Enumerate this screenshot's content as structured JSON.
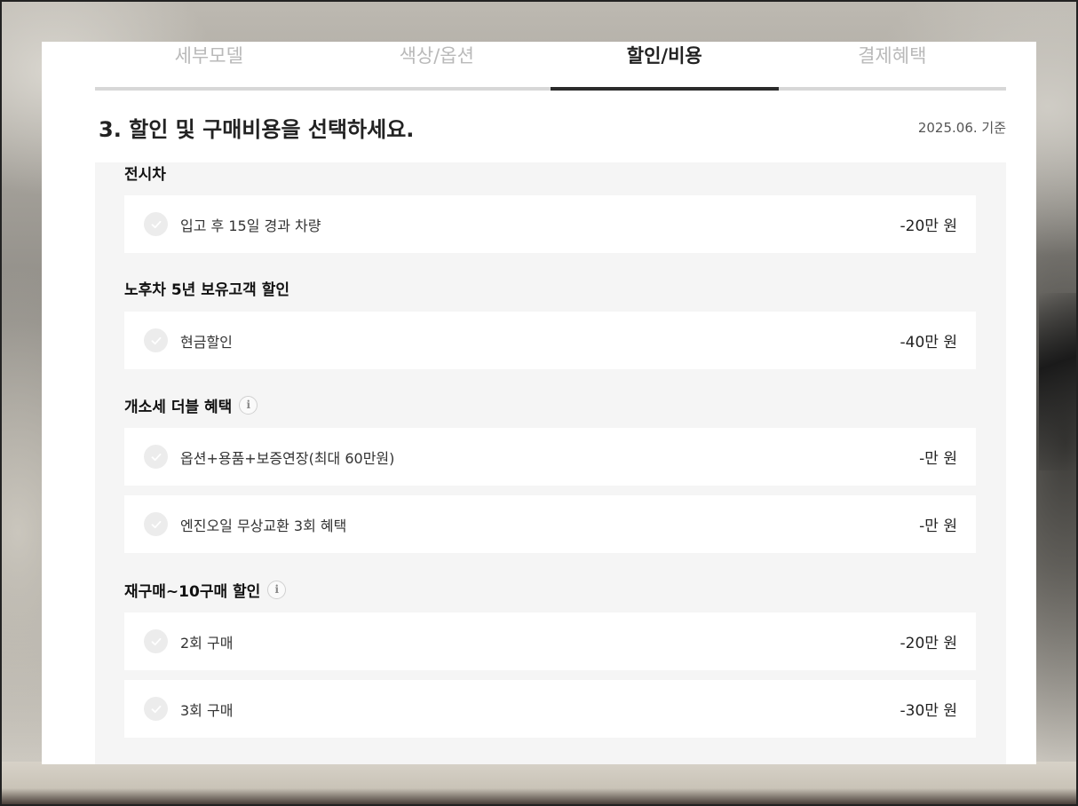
{
  "tabs": [
    {
      "label": "세부모델",
      "active": false
    },
    {
      "label": "색상/옵션",
      "active": false
    },
    {
      "label": "할인/비용",
      "active": true
    },
    {
      "label": "결제혜택",
      "active": false
    }
  ],
  "heading": {
    "title": "3. 할인 및 구매비용을 선택하세요.",
    "date_basis": "2025.06. 기준"
  },
  "groups": [
    {
      "title": "전시차",
      "has_info": false,
      "options": [
        {
          "label": "입고 후 15일 경과 차량",
          "value": "-20만 원"
        }
      ]
    },
    {
      "title": "노후차 5년 보유고객 할인",
      "has_info": false,
      "options": [
        {
          "label": "현금할인",
          "value": "-40만 원"
        }
      ]
    },
    {
      "title": "개소세 더블 혜택",
      "has_info": true,
      "info_icon_text": "i",
      "options": [
        {
          "label": "옵션+용품+보증연장(최대 60만원)",
          "value": "-만 원"
        },
        {
          "label": "엔진오일 무상교환 3회 혜택",
          "value": "-만 원"
        }
      ]
    },
    {
      "title": "재구매~10구매 할인",
      "has_info": true,
      "info_icon_text": "i",
      "options": [
        {
          "label": "2회 구매",
          "value": "-20만 원"
        },
        {
          "label": "3회 구매",
          "value": "-30만 원"
        }
      ]
    }
  ],
  "colors": {
    "active_tab_underline": "#2b2b2b",
    "inactive_tab_text": "#b9b9b9",
    "panel_background": "#f5f5f5",
    "check_circle": "#ececec"
  }
}
